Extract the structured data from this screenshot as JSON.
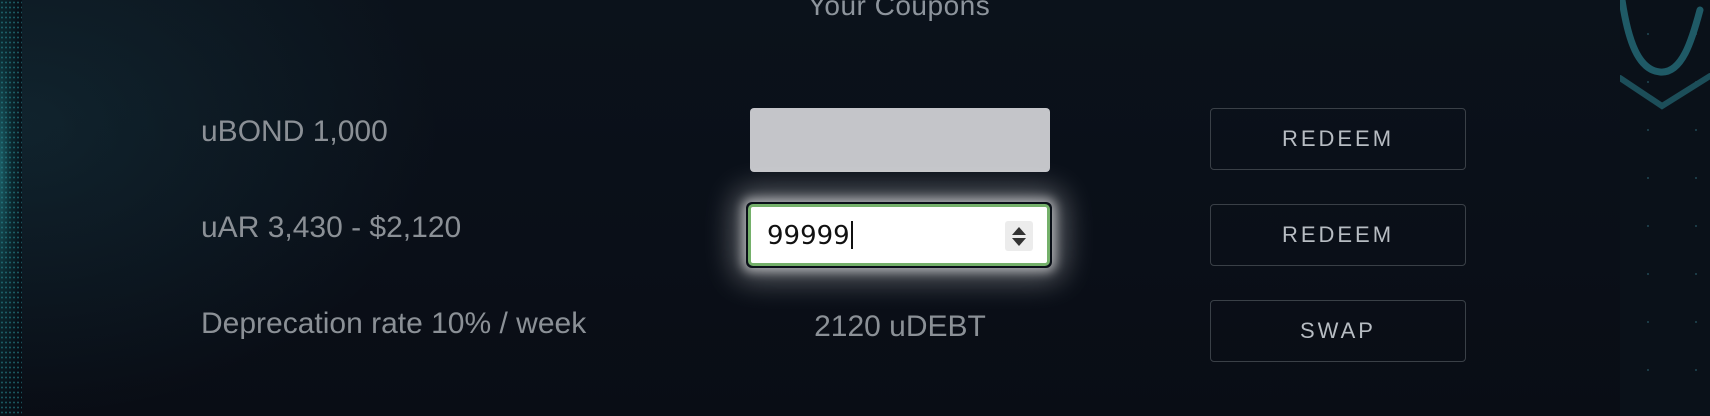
{
  "section": {
    "title": "Your Coupons"
  },
  "rows": [
    {
      "label": "uBOND 1,000",
      "button": "REDEEM"
    },
    {
      "label": "uAR 3,430 - $2,120",
      "input_value": "99999",
      "button": "REDEEM"
    },
    {
      "label": "Deprecation rate 10% / week",
      "result": "2120 uDEBT",
      "button": "SWAP"
    }
  ],
  "colors": {
    "input_focus_border": "#74b06a",
    "panel_bg": "#0a0f18",
    "text": "#8b9096"
  }
}
